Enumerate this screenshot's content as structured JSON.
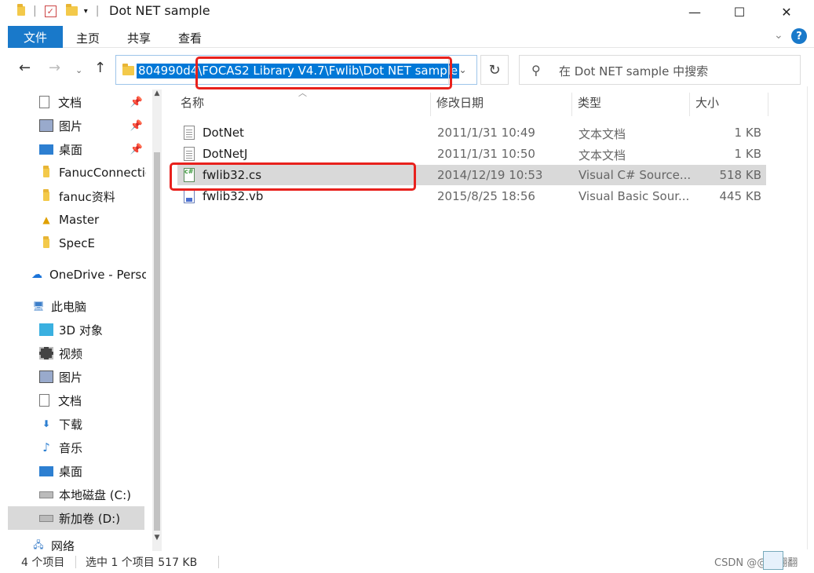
{
  "window": {
    "title": "Dot NET sample",
    "controls": {
      "minimize": "—",
      "maximize": "☐",
      "close": "✕"
    }
  },
  "ribbon": {
    "file_tab": "文件",
    "tabs": [
      "主页",
      "共享",
      "查看"
    ],
    "help": "?"
  },
  "address": {
    "path": "804990d4\\FOCAS2 Library V4.7\\Fwlib\\Dot NET sample",
    "dropdown": "⌄"
  },
  "search": {
    "placeholder": "在 Dot NET sample 中搜索"
  },
  "sidebar": {
    "items": [
      {
        "label": "文档",
        "icon": "document-icon",
        "pinned": true
      },
      {
        "label": "图片",
        "icon": "pictures-icon",
        "pinned": true
      },
      {
        "label": "桌面",
        "icon": "desktop-icon",
        "pinned": true
      },
      {
        "label": "FanucConnectio",
        "icon": "folder-icon",
        "pinned": false
      },
      {
        "label": "fanuc资料",
        "icon": "folder-icon",
        "pinned": false
      },
      {
        "label": "Master",
        "icon": "folder-warning-icon",
        "pinned": false
      },
      {
        "label": "SpecE",
        "icon": "folder-icon",
        "pinned": false
      },
      {
        "label": "OneDrive - Perso",
        "icon": "onedrive-icon",
        "pinned": false
      },
      {
        "label": "此电脑",
        "icon": "computer-icon",
        "pinned": false
      },
      {
        "label": "3D 对象",
        "icon": "3d-objects-icon",
        "pinned": false
      },
      {
        "label": "视频",
        "icon": "video-icon",
        "pinned": false
      },
      {
        "label": "图片",
        "icon": "pictures-icon",
        "pinned": false
      },
      {
        "label": "文档",
        "icon": "document-icon",
        "pinned": false
      },
      {
        "label": "下载",
        "icon": "download-icon",
        "pinned": false
      },
      {
        "label": "音乐",
        "icon": "music-icon",
        "pinned": false
      },
      {
        "label": "桌面",
        "icon": "desktop-icon",
        "pinned": false
      },
      {
        "label": "本地磁盘 (C:)",
        "icon": "drive-icon",
        "pinned": false
      },
      {
        "label": "新加卷 (D:)",
        "icon": "drive-icon",
        "pinned": false,
        "selected": true
      },
      {
        "label": "网络",
        "icon": "network-icon",
        "pinned": false
      }
    ]
  },
  "columns": {
    "name": "名称",
    "modified": "修改日期",
    "type": "类型",
    "size": "大小"
  },
  "files": [
    {
      "name": "DotNet",
      "modified": "2011/1/31 10:49",
      "type": "文本文档",
      "size": "1 KB",
      "icon": "text-file-icon"
    },
    {
      "name": "DotNetJ",
      "modified": "2011/1/31 10:50",
      "type": "文本文档",
      "size": "1 KB",
      "icon": "text-file-icon"
    },
    {
      "name": "fwlib32.cs",
      "modified": "2014/12/19 10:53",
      "type": "Visual C# Source...",
      "size": "518 KB",
      "icon": "csharp-file-icon",
      "selected": true
    },
    {
      "name": "fwlib32.vb",
      "modified": "2015/8/25 18:56",
      "type": "Visual Basic Sour...",
      "size": "445 KB",
      "icon": "vb-file-icon"
    }
  ],
  "status": {
    "item_count": "4 个项目",
    "selection": "选中 1 个项目  517 KB",
    "watermark": "CSDN @@播翻翻"
  },
  "colors": {
    "accent": "#0078d7",
    "ribbon_file_tab": "#1979ca",
    "highlight_box": "#e8211d",
    "selection_bg": "#d9d9d9"
  }
}
